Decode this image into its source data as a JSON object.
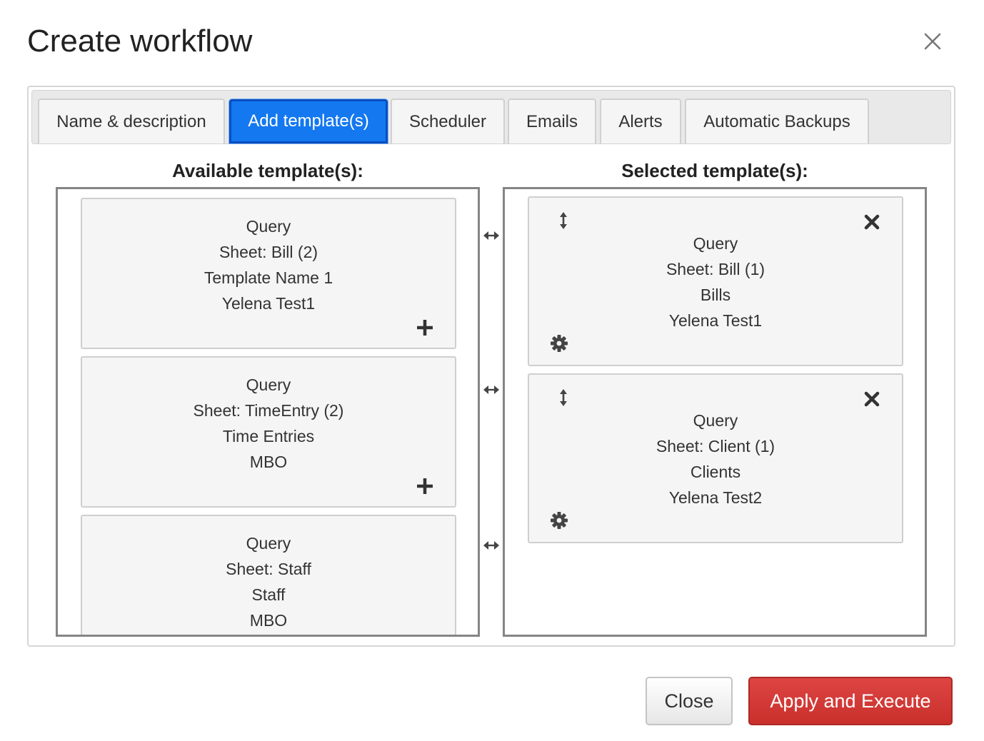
{
  "dialog": {
    "title": "Create workflow"
  },
  "tabs": [
    {
      "label": "Name & description"
    },
    {
      "label": "Add template(s)"
    },
    {
      "label": "Scheduler"
    },
    {
      "label": "Emails"
    },
    {
      "label": "Alerts"
    },
    {
      "label": "Automatic Backups"
    }
  ],
  "active_tab": "Add template(s)",
  "available": {
    "title": "Available template(s):",
    "items": [
      {
        "type": "Query",
        "sheet": "Sheet: Bill (2)",
        "name": "Template Name 1",
        "owner": "Yelena Test1"
      },
      {
        "type": "Query",
        "sheet": "Sheet: TimeEntry (2)",
        "name": "Time Entries",
        "owner": "MBO"
      },
      {
        "type": "Query",
        "sheet": "Sheet: Staff",
        "name": "Staff",
        "owner": "MBO"
      }
    ]
  },
  "selected": {
    "title": "Selected template(s):",
    "items": [
      {
        "type": "Query",
        "sheet": "Sheet: Bill (1)",
        "name": "Bills",
        "owner": "Yelena Test1"
      },
      {
        "type": "Query",
        "sheet": "Sheet: Client (1)",
        "name": "Clients",
        "owner": "Yelena Test2"
      }
    ]
  },
  "footer": {
    "close_label": "Close",
    "apply_label": "Apply and Execute"
  },
  "icons": {
    "close": "close-icon",
    "add": "plus-icon",
    "remove": "x-icon",
    "drag": "vertical-arrows-icon",
    "settings": "gear-icon",
    "swap": "horizontal-arrows-icon"
  },
  "colors": {
    "active_tab": "#1478f0",
    "apply_button": "#c9302c",
    "border": "#858585"
  }
}
